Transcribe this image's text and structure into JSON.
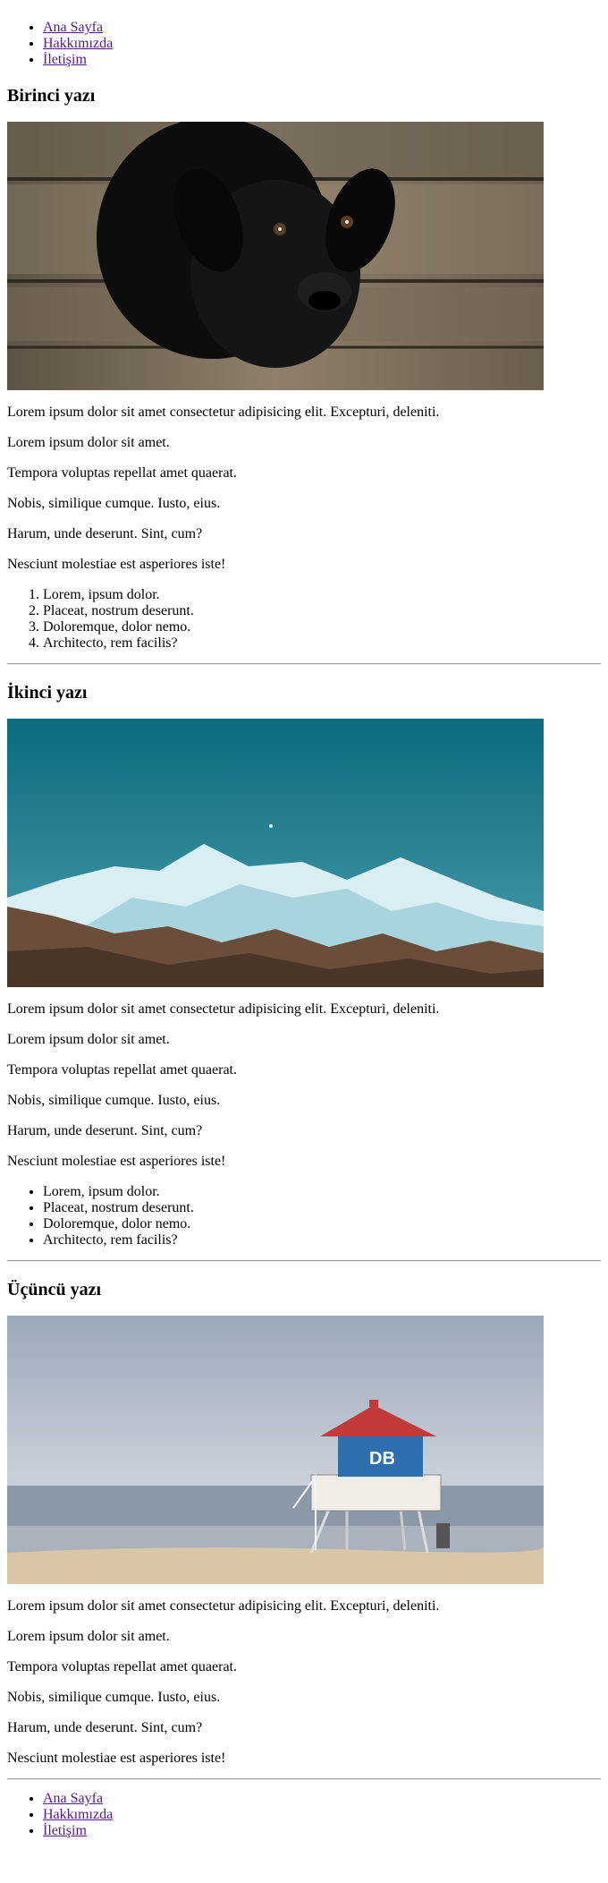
{
  "nav": {
    "items": [
      "Ana Sayfa",
      "Hakkımızda",
      "İletişim"
    ]
  },
  "posts": [
    {
      "title": "Birinci yazı",
      "image": {
        "subject": "black-puppy-on-wooden-floor"
      },
      "paragraphs": [
        "Lorem ipsum dolor sit amet consectetur adipisicing elit. Excepturi, deleniti.",
        "Lorem ipsum dolor sit amet.",
        "Tempora voluptas repellat amet quaerat.",
        "Nobis, similique cumque. Iusto, eius.",
        "Harum, unde deserunt. Sint, cum?",
        "Nesciunt molestiae est asperiores iste!"
      ],
      "list_type": "ordered",
      "list": [
        "Lorem, ipsum dolor.",
        "Placeat, nostrum deserunt.",
        "Doloremque, dolor nemo.",
        "Architecto, rem facilis?"
      ]
    },
    {
      "title": "İkinci yazı",
      "image": {
        "subject": "snowy-mountains-under-teal-sky"
      },
      "paragraphs": [
        "Lorem ipsum dolor sit amet consectetur adipisicing elit. Excepturi, deleniti.",
        "Lorem ipsum dolor sit amet.",
        "Tempora voluptas repellat amet quaerat.",
        "Nobis, similique cumque. Iusto, eius.",
        "Harum, unde deserunt. Sint, cum?",
        "Nesciunt molestiae est asperiores iste!"
      ],
      "list_type": "unordered",
      "list": [
        "Lorem, ipsum dolor.",
        "Placeat, nostrum deserunt.",
        "Doloremque, dolor nemo.",
        "Architecto, rem facilis?"
      ]
    },
    {
      "title": "Üçüncü yazı",
      "image": {
        "subject": "lifeguard-tower-on-beach"
      },
      "paragraphs": [
        "Lorem ipsum dolor sit amet consectetur adipisicing elit. Excepturi, deleniti.",
        "Lorem ipsum dolor sit amet.",
        "Tempora voluptas repellat amet quaerat.",
        "Nobis, similique cumque. Iusto, eius.",
        "Harum, unde deserunt. Sint, cum?",
        "Nesciunt molestiae est asperiores iste!"
      ]
    }
  ],
  "colors": {
    "link": "#551a8b",
    "text": "#000000",
    "divider": "#9a9a9a"
  }
}
